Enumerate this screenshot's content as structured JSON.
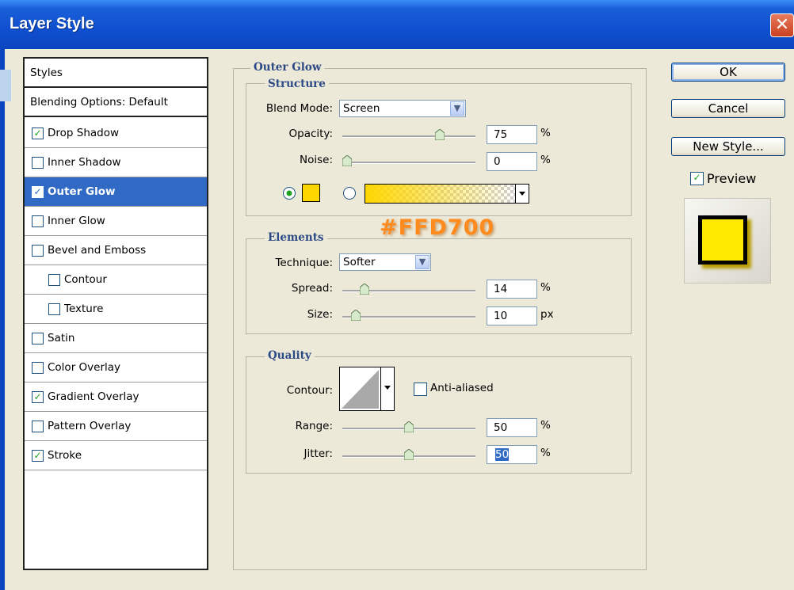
{
  "window": {
    "title": "Layer Style",
    "close_glyph": "✕"
  },
  "styles_list": {
    "header": "Styles",
    "blending": "Blending Options: Default",
    "items": [
      {
        "label": "Drop Shadow",
        "checked": true,
        "selected": false,
        "indent": false
      },
      {
        "label": "Inner Shadow",
        "checked": false,
        "selected": false,
        "indent": false
      },
      {
        "label": "Outer Glow",
        "checked": true,
        "selected": true,
        "indent": false
      },
      {
        "label": "Inner Glow",
        "checked": false,
        "selected": false,
        "indent": false
      },
      {
        "label": "Bevel and Emboss",
        "checked": false,
        "selected": false,
        "indent": false
      },
      {
        "label": "Contour",
        "checked": false,
        "selected": false,
        "indent": true
      },
      {
        "label": "Texture",
        "checked": false,
        "selected": false,
        "indent": true
      },
      {
        "label": "Satin",
        "checked": false,
        "selected": false,
        "indent": false
      },
      {
        "label": "Color Overlay",
        "checked": false,
        "selected": false,
        "indent": false
      },
      {
        "label": "Gradient Overlay",
        "checked": true,
        "selected": false,
        "indent": false
      },
      {
        "label": "Pattern Overlay",
        "checked": false,
        "selected": false,
        "indent": false
      },
      {
        "label": "Stroke",
        "checked": true,
        "selected": false,
        "indent": false
      }
    ]
  },
  "outer_glow": {
    "title": "Outer Glow",
    "structure": {
      "title": "Structure",
      "blend_mode_label": "Blend Mode:",
      "blend_mode_value": "Screen",
      "opacity_label": "Opacity:",
      "opacity_value": "75",
      "opacity_level": 0.75,
      "opacity_unit": "%",
      "noise_label": "Noise:",
      "noise_value": "0",
      "noise_level": 0,
      "noise_unit": "%",
      "glow_color": "#FFD700"
    },
    "annotation": "#FFD700",
    "elements": {
      "title": "Elements",
      "technique_label": "Technique:",
      "technique_value": "Softer",
      "spread_label": "Spread:",
      "spread_value": "14",
      "spread_level": 0.14,
      "spread_unit": "%",
      "size_label": "Size:",
      "size_value": "10",
      "size_unit": "px"
    },
    "quality": {
      "title": "Quality",
      "contour_label": "Contour:",
      "anti_aliased_label": "Anti-aliased",
      "range_label": "Range:",
      "range_value": "50",
      "range_level": 0.5,
      "range_unit": "%",
      "jitter_label": "Jitter:",
      "jitter_value": "50",
      "jitter_level": 0.5,
      "jitter_unit": "%"
    }
  },
  "buttons": {
    "ok": "OK",
    "cancel": "Cancel",
    "new_style": "New Style...",
    "preview_label": "Preview",
    "preview_checked": true
  },
  "colors": {
    "accent": "#316AC5",
    "titlebar": "#0B45C0",
    "preview_fill": "#FFE900"
  }
}
